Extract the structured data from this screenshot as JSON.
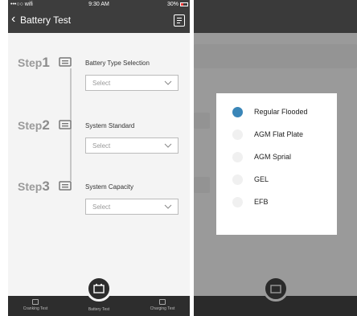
{
  "left": {
    "status": {
      "carrier": "•••○○ wifi",
      "time": "9:30 AM",
      "battery": "30%"
    },
    "nav": {
      "back": "‹",
      "title": "Battery Test"
    },
    "steps": [
      {
        "word": "Step",
        "num": "1",
        "name": "Battery Type Selection",
        "placeholder": "Select"
      },
      {
        "word": "Step",
        "num": "2",
        "name": "System Standard",
        "placeholder": "Select"
      },
      {
        "word": "Step",
        "num": "3",
        "name": "System Capacity",
        "placeholder": "Select"
      }
    ],
    "tabs": [
      {
        "label": "Cranking Test"
      },
      {
        "label": "Battery Test"
      },
      {
        "label": "Charging Test"
      }
    ]
  },
  "right": {
    "options": [
      {
        "label": "Regular Flooded",
        "selected": true
      },
      {
        "label": "AGM Flat Plate",
        "selected": false
      },
      {
        "label": "AGM Sprial",
        "selected": false
      },
      {
        "label": "GEL",
        "selected": false
      },
      {
        "label": "EFB",
        "selected": false
      }
    ]
  },
  "colors": {
    "accent": "#3a86b8",
    "bar": "#3d3d3d"
  }
}
